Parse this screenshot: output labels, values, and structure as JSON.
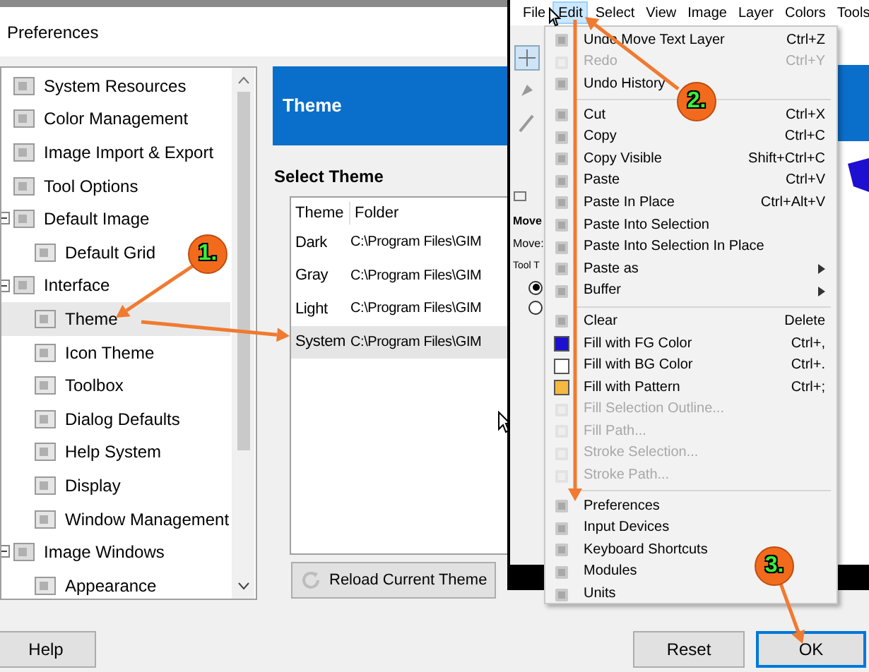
{
  "window": {
    "title": "Preferences"
  },
  "sidebar": {
    "items": [
      {
        "label": "System Resources",
        "selected": false
      },
      {
        "label": "Color Management",
        "selected": false
      },
      {
        "label": "Image Import & Export",
        "selected": false
      },
      {
        "label": "Tool Options",
        "selected": false
      },
      {
        "label": "Default Image",
        "selected": false,
        "expanded": true,
        "children": [
          {
            "label": "Default Grid",
            "selected": false
          }
        ]
      },
      {
        "label": "Interface",
        "selected": false,
        "expanded": true,
        "children": [
          {
            "label": "Theme",
            "selected": true
          },
          {
            "label": "Icon Theme",
            "selected": false
          },
          {
            "label": "Toolbox",
            "selected": false
          },
          {
            "label": "Dialog Defaults",
            "selected": false
          },
          {
            "label": "Help System",
            "selected": false
          },
          {
            "label": "Display",
            "selected": false
          },
          {
            "label": "Window Management",
            "selected": false
          }
        ]
      },
      {
        "label": "Image Windows",
        "selected": false,
        "expanded": true,
        "children": [
          {
            "label": "Appearance",
            "selected": false
          }
        ]
      }
    ]
  },
  "panel": {
    "header": "Theme",
    "section_title": "Select Theme",
    "table": {
      "columns": [
        "Theme",
        "Folder"
      ],
      "rows": [
        {
          "cells": [
            "Dark",
            "C:\\Program Files\\GIM"
          ],
          "selected": false
        },
        {
          "cells": [
            "Gray",
            "C:\\Program Files\\GIM"
          ],
          "selected": false
        },
        {
          "cells": [
            "Light",
            "C:\\Program Files\\GIM"
          ],
          "selected": false
        },
        {
          "cells": [
            "System",
            "C:\\Program Files\\GIM"
          ],
          "selected": true
        }
      ]
    },
    "reload_button": "Reload Current Theme"
  },
  "buttons": {
    "help": "Help",
    "reset": "Reset",
    "ok": "OK"
  },
  "gimp": {
    "menubar": [
      {
        "label": "File",
        "selected": false
      },
      {
        "label": "Edit",
        "selected": true
      },
      {
        "label": "Select",
        "selected": false
      },
      {
        "label": "View",
        "selected": false
      },
      {
        "label": "Image",
        "selected": false
      },
      {
        "label": "Layer",
        "selected": false
      },
      {
        "label": "Colors",
        "selected": false
      },
      {
        "label": "Tools",
        "selected": false
      }
    ],
    "tool_options": {
      "title": "Move",
      "row_1": "Move:",
      "row_2": "Tool T",
      "radios": [
        {
          "selected": true
        },
        {
          "selected": false
        }
      ]
    },
    "edit_menu": [
      {
        "kind": "item",
        "label": "Undo Move Text Layer",
        "shortcut": "Ctrl+Z",
        "disabled": false
      },
      {
        "kind": "item",
        "label": "Redo",
        "shortcut": "Ctrl+Y",
        "disabled": true
      },
      {
        "kind": "item",
        "label": "Undo History",
        "disabled": false
      },
      {
        "kind": "separator"
      },
      {
        "kind": "item",
        "label": "Cut",
        "shortcut": "Ctrl+X",
        "disabled": false
      },
      {
        "kind": "item",
        "label": "Copy",
        "shortcut": "Ctrl+C",
        "disabled": false
      },
      {
        "kind": "item",
        "label": "Copy Visible",
        "shortcut": "Shift+Ctrl+C",
        "disabled": false
      },
      {
        "kind": "item",
        "label": "Paste",
        "shortcut": "Ctrl+V",
        "disabled": false
      },
      {
        "kind": "item",
        "label": "Paste In Place",
        "shortcut": "Ctrl+Alt+V",
        "disabled": false
      },
      {
        "kind": "item",
        "label": "Paste Into Selection",
        "disabled": false
      },
      {
        "kind": "item",
        "label": "Paste Into Selection In Place",
        "disabled": false
      },
      {
        "kind": "submenu",
        "label": "Paste as",
        "disabled": false
      },
      {
        "kind": "submenu",
        "label": "Buffer",
        "disabled": false
      },
      {
        "kind": "separator"
      },
      {
        "kind": "item",
        "label": "Clear",
        "shortcut": "Delete",
        "disabled": false
      },
      {
        "kind": "swatch",
        "label": "Fill with FG Color",
        "shortcut": "Ctrl+,",
        "color": "#1e10d0",
        "disabled": false
      },
      {
        "kind": "swatch",
        "label": "Fill with BG Color",
        "shortcut": "Ctrl+.",
        "color": "#ffffff",
        "disabled": false
      },
      {
        "kind": "swatch",
        "label": "Fill with Pattern",
        "shortcut": "Ctrl+;",
        "color": "#f5b841",
        "disabled": false
      },
      {
        "kind": "item",
        "label": "Fill Selection Outline...",
        "disabled": true
      },
      {
        "kind": "item",
        "label": "Fill Path...",
        "disabled": true
      },
      {
        "kind": "item",
        "label": "Stroke Selection...",
        "disabled": true
      },
      {
        "kind": "item",
        "label": "Stroke Path...",
        "disabled": true
      },
      {
        "kind": "separator"
      },
      {
        "kind": "item",
        "label": "Preferences",
        "disabled": false
      },
      {
        "kind": "item",
        "label": "Input Devices",
        "disabled": false
      },
      {
        "kind": "item",
        "label": "Keyboard Shortcuts",
        "disabled": false
      },
      {
        "kind": "item",
        "label": "Modules",
        "disabled": false
      },
      {
        "kind": "item",
        "label": "Units",
        "disabled": false
      }
    ]
  },
  "annotations": [
    {
      "label": "1."
    },
    {
      "label": "2."
    },
    {
      "label": "3."
    }
  ]
}
